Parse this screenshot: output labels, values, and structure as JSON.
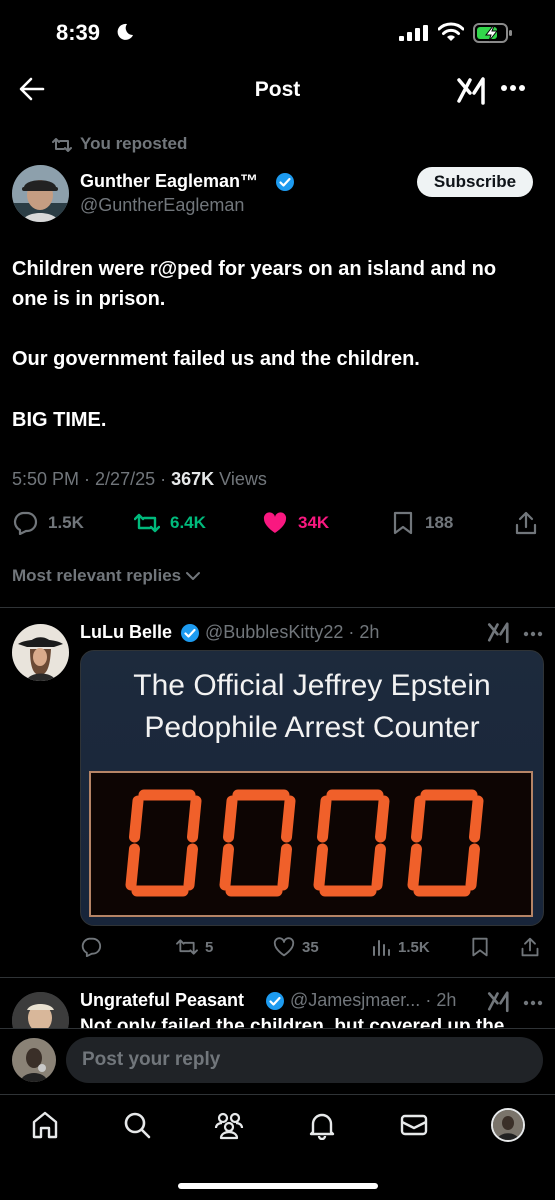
{
  "status_bar": {
    "time": "8:39"
  },
  "header": {
    "title": "Post"
  },
  "post": {
    "repost_label": "You reposted",
    "author_name": "Gunther Eagleman™",
    "author_handle": "@GuntherEagleman",
    "subscribe_label": "Subscribe",
    "lines": [
      "Children were r@ped for years on an island and no",
      "one is in prison.",
      "Our government failed us and the children.",
      "BIG TIME."
    ],
    "time": "5:50 PM",
    "date": "2/27/25",
    "views_count": "367K",
    "views_label": "Views",
    "replies": "1.5K",
    "reposts": "6.4K",
    "likes": "34K",
    "bookmarks": "188"
  },
  "replies_filter": "Most relevant replies",
  "reply1": {
    "name": "LuLu Belle",
    "handle": "@BubblesKitty22",
    "age": "2h",
    "image_title_1": "The Official Jeffrey Epstein",
    "image_title_2": "Pedophile Arrest Counter",
    "counter_value": "0000",
    "reposts": "5",
    "likes": "35",
    "views": "1.5K"
  },
  "reply2": {
    "name": "Ungrateful Peasant",
    "handle": "@Jamesjmaer...",
    "age": "2h",
    "text": "Not only failed the children, but covered up the"
  },
  "composer": {
    "placeholder": "Post your reply"
  },
  "colors": {
    "background": "#000000",
    "verified": "#1d9bf0",
    "repost_active": "#00ba7c",
    "like_active": "#f91880",
    "secondary_text": "#71767b",
    "counter_digit": "#f0602a"
  },
  "icons": [
    "moon-icon",
    "signal-icon",
    "wifi-icon",
    "battery-charging-icon",
    "back-arrow-icon",
    "grok-icon",
    "more-icon",
    "repost-icon",
    "verified-icon",
    "reply-icon",
    "like-icon",
    "bookmark-icon",
    "share-icon",
    "views-icon",
    "chevron-down-icon",
    "home-icon",
    "search-icon",
    "communities-icon",
    "bell-icon",
    "mail-icon"
  ]
}
